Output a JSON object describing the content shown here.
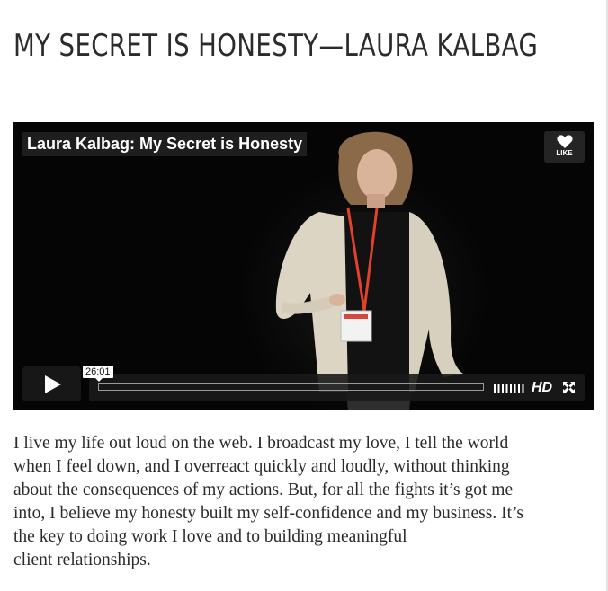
{
  "page": {
    "title": "MY SECRET IS HONESTY—LAURA KALBAG"
  },
  "video": {
    "title": "Laura Kalbag: My Secret is Honesty",
    "like_label": "LIKE",
    "time_display": "26:01",
    "progress_percent": 0,
    "hd_label": "HD",
    "icons": [
      "heart-icon",
      "play-icon",
      "volume-icon",
      "fullscreen-icon"
    ],
    "accent_color": "#00adef"
  },
  "article": {
    "lines": [
      "I live my life out loud on the web. I broadcast my love, I tell the world",
      "when I feel down, and I overreact quickly and loudly, without thinking",
      "about the consequences of my actions. But, for all the fights it’s got me",
      "into, I believe my honesty built my self-confidence and my business. It’s",
      "the key to doing work I love and to building meaningful",
      "client relationships."
    ]
  }
}
